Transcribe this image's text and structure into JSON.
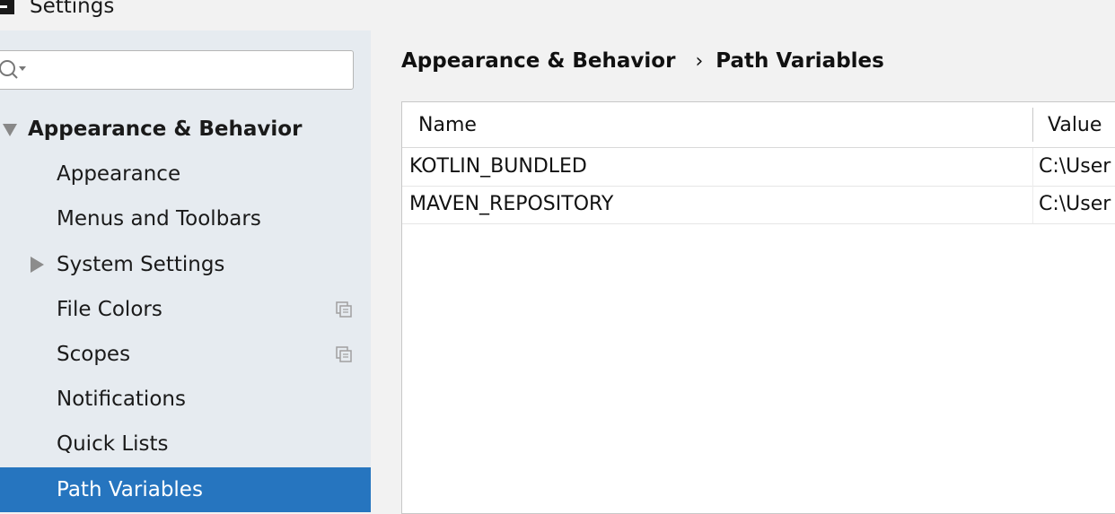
{
  "window": {
    "title": "Settings"
  },
  "search": {
    "value": "",
    "placeholder": ""
  },
  "sidebar": {
    "items": [
      {
        "label": "Appearance & Behavior",
        "type": "group",
        "expanded": true
      },
      {
        "label": "Appearance"
      },
      {
        "label": "Menus and Toolbars"
      },
      {
        "label": "System Settings",
        "collapsed": true
      },
      {
        "label": "File Colors",
        "icon": "copy-settings-icon"
      },
      {
        "label": "Scopes",
        "icon": "copy-settings-icon"
      },
      {
        "label": "Notifications"
      },
      {
        "label": "Quick Lists"
      },
      {
        "label": "Path Variables",
        "selected": true
      }
    ]
  },
  "breadcrumb": {
    "parent": "Appearance & Behavior",
    "separator": "›",
    "current": "Path Variables"
  },
  "table": {
    "columns": [
      "Name",
      "Value"
    ],
    "rows": [
      {
        "name": "KOTLIN_BUNDLED",
        "value": "C:\\User"
      },
      {
        "name": "MAVEN_REPOSITORY",
        "value": "C:\\User"
      }
    ]
  },
  "colors": {
    "sidebar_bg": "#e6ebf0",
    "selection": "#2675bf",
    "panel_bg": "#f2f2f2"
  }
}
